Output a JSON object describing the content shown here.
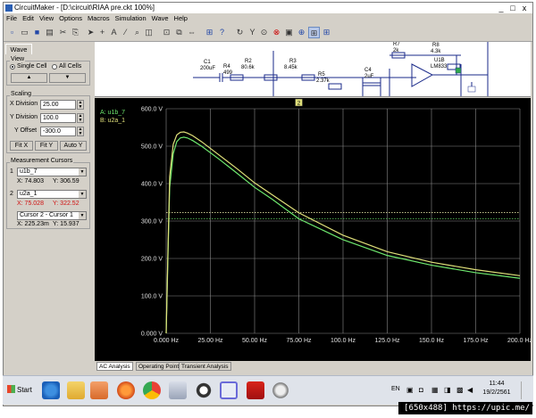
{
  "window": {
    "title": "CircuitMaker - [D:\\circuit\\RIAA pre.ckt 100%]",
    "minimize": "_",
    "maximize": "□",
    "close": "x"
  },
  "menu": [
    "File",
    "Edit",
    "View",
    "Options",
    "Macros",
    "Simulation",
    "Wave",
    "Help"
  ],
  "left_panel": {
    "tab": "Wave",
    "view": {
      "label": "View",
      "single_cell": "Single Cell",
      "all_cells": "All Cells",
      "selected": "single_cell"
    },
    "scaling": {
      "label": "Scaling",
      "x_division_label": "X Division",
      "x_division": "25.00",
      "y_division_label": "Y Division",
      "y_division": "100.0",
      "y_offset_label": "Y Offset",
      "y_offset": "-300.0",
      "fit_x": "Fit X",
      "fit_y": "Fit Y",
      "auto_y": "Auto Y"
    },
    "cursors": {
      "label": "Measurement Cursors",
      "c1_num": "1",
      "c1_trace": "u1b_7",
      "c1_x": "X: 74.803",
      "c1_y": "Y: 306.59",
      "c2_num": "2",
      "c2_trace": "u2a_1",
      "c2_x": "X: 75.028",
      "c2_y": "Y: 322.52",
      "diff_select": "Cursor 2 - Cursor 1",
      "diff_x": "X: 225.23m",
      "diff_y": "Y: 15.937"
    }
  },
  "schematic": {
    "labels": [
      "C1",
      "200uF",
      "R4",
      "499",
      "R2",
      "80.6k",
      "R3",
      "8.45k",
      "R5",
      "2.37k",
      "C4",
      "2uF",
      "R7",
      "2k",
      "R8",
      "4.3k",
      "U1B",
      "LM833"
    ]
  },
  "bottom_tabs": [
    "AC Analysis",
    "Operating Point",
    "Transient Analysis"
  ],
  "chart_data": {
    "type": "line",
    "title": "",
    "xlabel": "",
    "ylabel": "",
    "xlim": [
      0,
      200
    ],
    "ylim": [
      0,
      600
    ],
    "x_ticks": [
      "0.000 Hz",
      "25.00 Hz",
      "50.00 Hz",
      "75.00 Hz",
      "100.0 Hz",
      "125.0 Hz",
      "150.0 Hz",
      "175.0 Hz",
      "200.0 Hz"
    ],
    "y_ticks": [
      "0.000 V",
      "100.0 V",
      "200.0 V",
      "300.0 V",
      "400.0 V",
      "500.0 V",
      "600.0 V"
    ],
    "grid": true,
    "legend_position": "top-left",
    "cursor_marker": "2",
    "series": [
      {
        "name": "A: u1b_7",
        "color": "#6ee86e",
        "x": [
          0,
          1,
          2,
          4,
          6,
          8,
          10,
          12,
          15,
          20,
          30,
          40,
          50,
          60,
          75,
          100,
          125,
          150,
          175,
          200
        ],
        "values": [
          0,
          200,
          390,
          480,
          512,
          522,
          524,
          522,
          515,
          500,
          465,
          428,
          390,
          358,
          306,
          250,
          208,
          182,
          162,
          147
        ]
      },
      {
        "name": "B: u2a_1",
        "color": "#e0e07a",
        "x": [
          0,
          1,
          2,
          4,
          6,
          8,
          10,
          12,
          15,
          20,
          30,
          40,
          50,
          60,
          75,
          100,
          125,
          150,
          175,
          200
        ],
        "values": [
          0,
          220,
          420,
          505,
          530,
          537,
          538,
          535,
          528,
          512,
          476,
          440,
          402,
          370,
          322,
          262,
          218,
          190,
          170,
          154
        ]
      }
    ],
    "cursor_lines": [
      306.59,
      322.52
    ]
  },
  "taskbar": {
    "start": "Start",
    "lang": "EN",
    "time": "11:44",
    "date": "19/2/2561"
  },
  "watermark": "[650x488] https://upic.me/"
}
